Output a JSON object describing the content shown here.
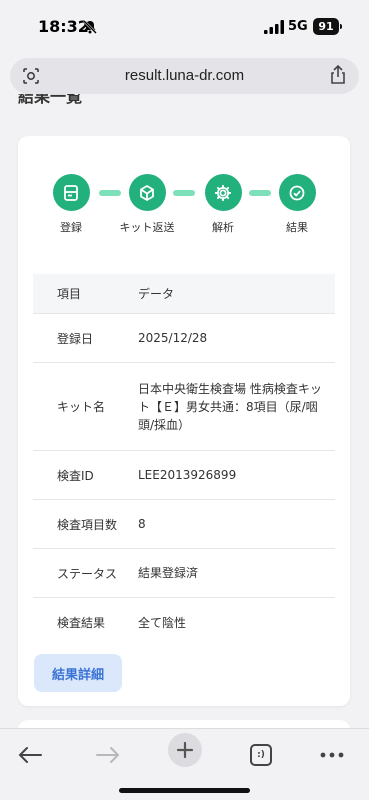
{
  "status_bar": {
    "time": "18:32",
    "network": "5G",
    "battery": "91"
  },
  "browser": {
    "url": "result.luna-dr.com"
  },
  "page": {
    "heading": "結果一覧"
  },
  "stepper": {
    "steps": [
      {
        "label": "登録",
        "icon": "register-icon"
      },
      {
        "label": "キット返送",
        "icon": "return-kit-icon"
      },
      {
        "label": "解析",
        "icon": "gear-icon"
      },
      {
        "label": "結果",
        "icon": "check-icon"
      }
    ],
    "color": "#22b07d",
    "connector_color": "#7ee0b8"
  },
  "table": {
    "headers": {
      "key": "項目",
      "value": "データ"
    },
    "rows": [
      {
        "key": "登録日",
        "value": "2025/12/28"
      },
      {
        "key": "キット名",
        "value": "日本中央衛生検査場 性病検査キット【Ｅ】男女共通：8項目（尿/咽頭/採血）"
      },
      {
        "key": "検査ID",
        "value": "LEE2013926899"
      },
      {
        "key": "検査項目数",
        "value": "8"
      },
      {
        "key": "ステータス",
        "value": "結果登録済"
      },
      {
        "key": "検査結果",
        "value": "全て陰性"
      }
    ]
  },
  "detail_button": {
    "label": "結果詳細"
  },
  "toolbar": {
    "tabs_label": ":)"
  }
}
